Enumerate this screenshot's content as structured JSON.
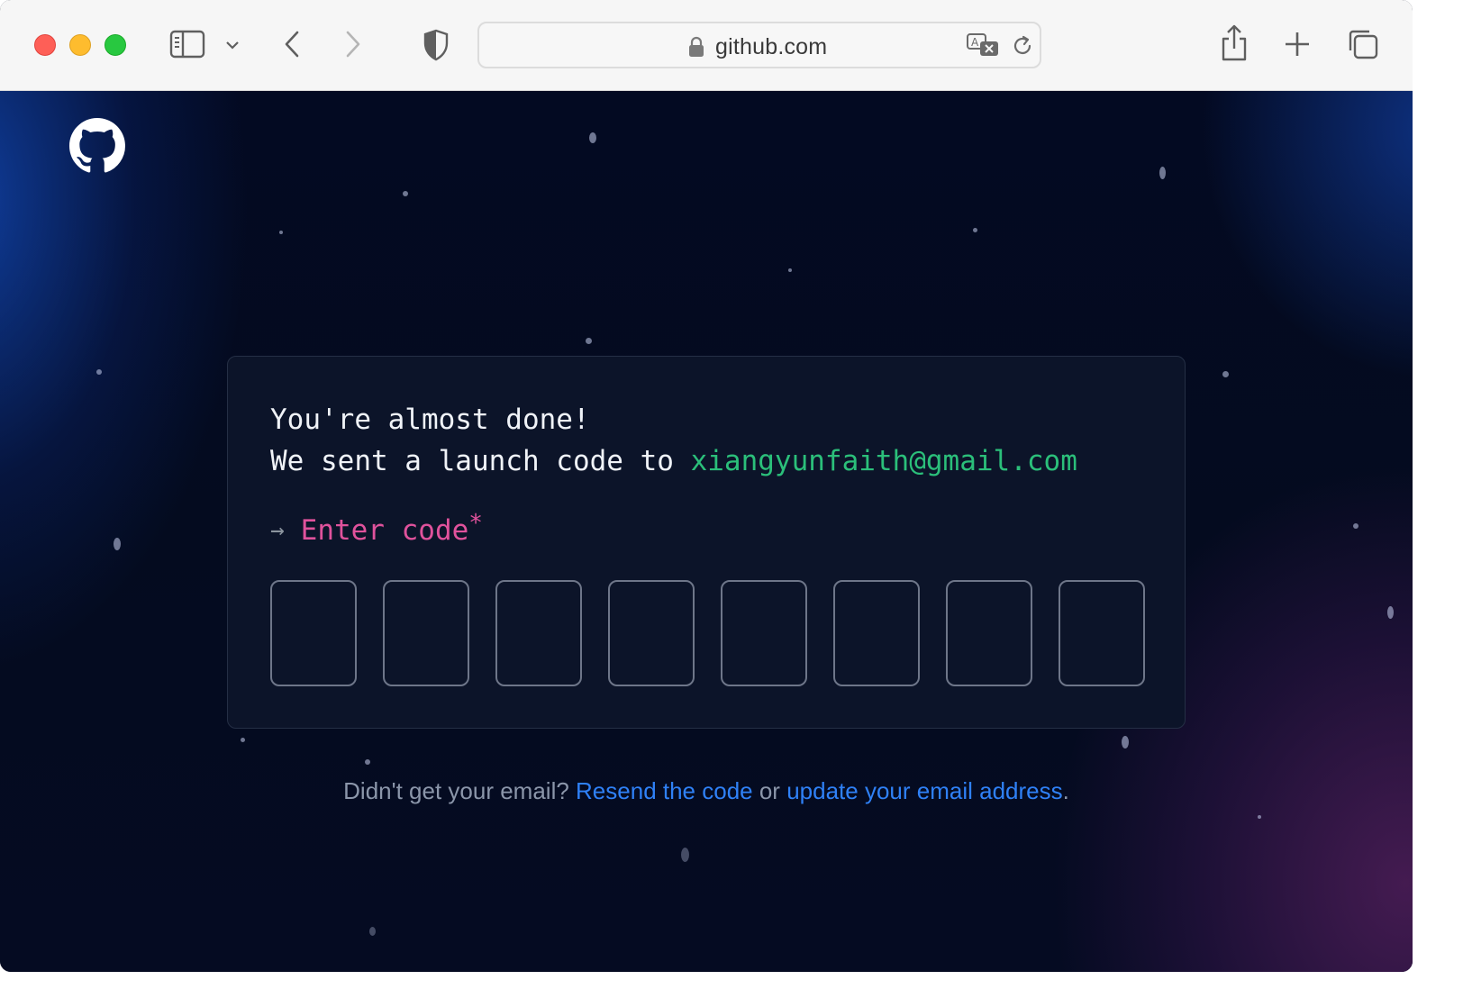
{
  "browser": {
    "url": "github.com",
    "colors": {
      "close": "#fe5f57",
      "minimize": "#febc2e",
      "zoom": "#28c840"
    }
  },
  "page": {
    "heading": "You're almost done!",
    "sent_prefix": "We sent a launch code to ",
    "email": "xiangyunfaith@gmail.com",
    "prompt_arrow": "→",
    "prompt_label": "Enter code",
    "prompt_required": "*",
    "code_boxes": [
      "",
      "",
      "",
      "",
      "",
      "",
      "",
      ""
    ],
    "footer": {
      "prefix": "Didn't get your email? ",
      "resend_link": "Resend the code",
      "middle": " or ",
      "update_link": "update your email address",
      "suffix": "."
    },
    "colors": {
      "email": "#2bbf7a",
      "prompt": "#e0529c",
      "link": "#2f81f7",
      "card_bg": "#0c1429"
    }
  }
}
